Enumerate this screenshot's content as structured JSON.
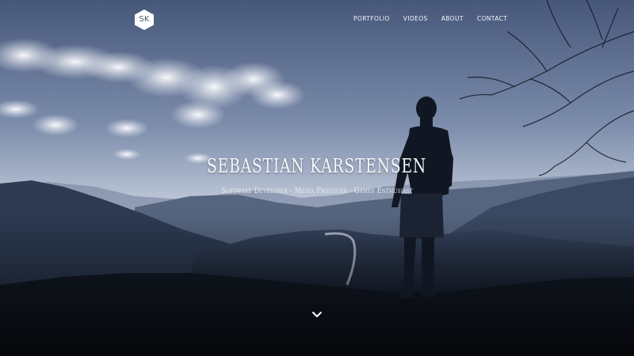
{
  "logo": {
    "text": "SK",
    "icon": "hexagon-monogram-logo"
  },
  "nav": {
    "items": [
      {
        "label": "PORTFOLIO"
      },
      {
        "label": "VIDEOS"
      },
      {
        "label": "ABOUT"
      },
      {
        "label": "CONTACT"
      }
    ]
  },
  "hero": {
    "title": "SEBASTIAN KARSTENSEN",
    "subtitle": "Software Developer - Media Producer - Games Enthusiast",
    "scroll_icon": "chevron-down-icon"
  },
  "colors": {
    "sky_top": "#4a5a7a",
    "sky_mid": "#8d9bb5",
    "horizon": "#c3ccdc",
    "mountains": "#1e2a40",
    "foreground": "#0b0f17",
    "text": "#ffffff",
    "logo_fill": "#ffffff",
    "logo_text": "#4d5a70"
  }
}
